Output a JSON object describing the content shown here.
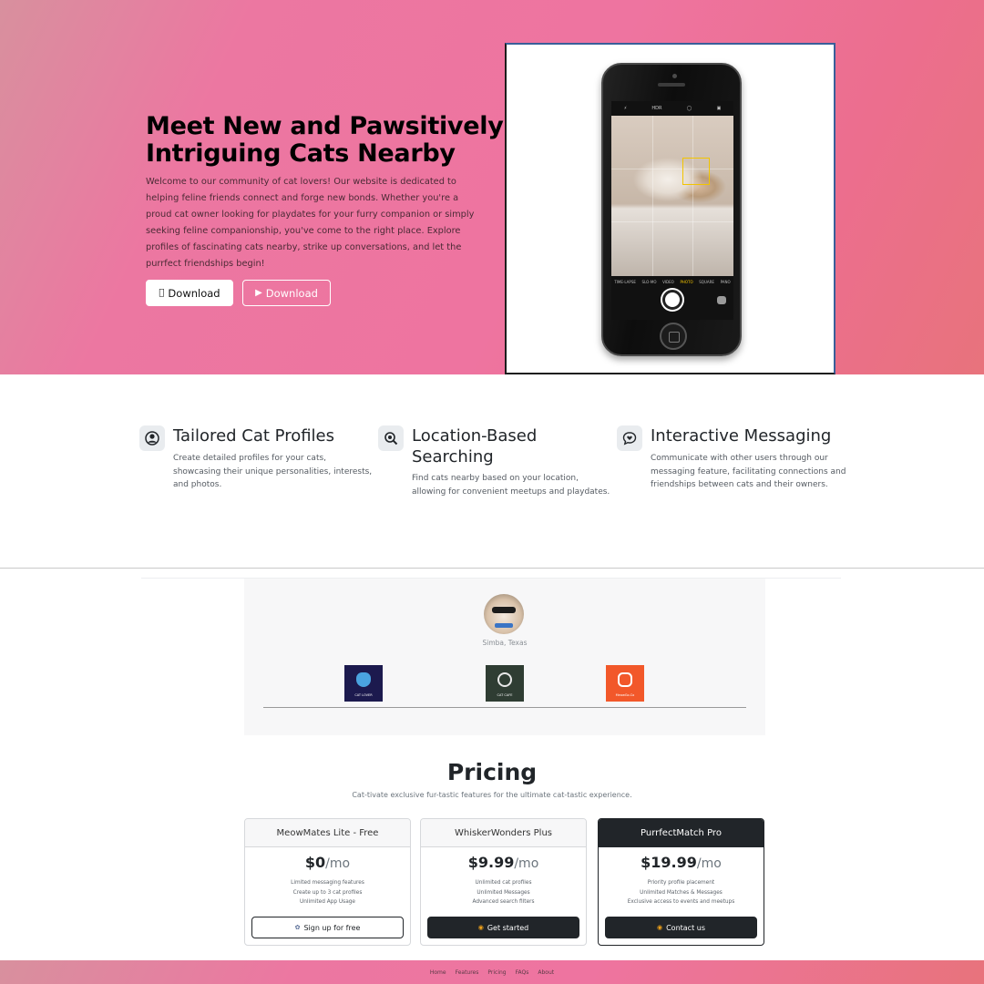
{
  "hero": {
    "title": "Meet New and Pawsitively Intriguing Cats Nearby",
    "text": "Welcome to our community of cat lovers! Our website is dedicated to helping feline friends connect and forge new bonds. Whether you're a proud cat owner looking for playdates for your furry companion or simply seeking feline companionship, you've come to the right place. Explore profiles of fascinating cats nearby, strike up conversations, and let the purrfect friendships begin!",
    "download_apple": "Download",
    "download_play": "Download",
    "apple_icon": "apple-icon",
    "play_icon": "play-store-icon"
  },
  "phone": {
    "modes": [
      "TIME-LAPSE",
      "SLO-MO",
      "VIDEO",
      "PHOTO",
      "SQUARE",
      "PANO"
    ],
    "top_items": [
      "HDR"
    ]
  },
  "features": [
    {
      "icon": "user-circle-icon",
      "title": "Tailored Cat Profiles",
      "text": "Create detailed profiles for your cats, showcasing their unique personalities, interests, and photos."
    },
    {
      "icon": "search-location-icon",
      "title": "Location-Based Searching",
      "text": "Find cats nearby based on your location, allowing for convenient meetups and playdates."
    },
    {
      "icon": "message-heart-icon",
      "title": "Interactive Messaging",
      "text": "Communicate with other users through our messaging feature, facilitating connections and friendships between cats and their owners."
    }
  ],
  "testimonial": {
    "name": "Simba, Texas",
    "logos": [
      "CAT LOVER",
      "CAT CAFE",
      "MeowGo.Co"
    ]
  },
  "pricing": {
    "title": "Pricing",
    "subtitle": "Cat-tivate exclusive fur-tastic features for the ultimate cat-tastic experience.",
    "plans": [
      {
        "name": "MeowMates Lite - Free",
        "price": "$0",
        "per": "/mo",
        "features": [
          "Limited messaging features",
          "Create up to 3 cat profiles",
          "Unlimited App Usage"
        ],
        "cta": "Sign up for free"
      },
      {
        "name": "WhiskerWonders Plus",
        "price": "$9.99",
        "per": "/mo",
        "features": [
          "Unlimited cat profiles",
          "Unlimited Messages",
          "Advanced search filters"
        ],
        "cta": "Get started"
      },
      {
        "name": "PurrfectMatch Pro",
        "price": "$19.99",
        "per": "/mo",
        "features": [
          "Priority profile placement",
          "Unlimited Matches & Messages",
          "Exclusive access to events and meetups"
        ],
        "cta": "Contact us"
      }
    ]
  },
  "footer": {
    "links": [
      "Home",
      "Features",
      "Pricing",
      "FAQs",
      "About"
    ]
  },
  "colors": {
    "hero_pink": "#ee74a0",
    "dark": "#212529",
    "accent_orange": "#f0a21a"
  }
}
